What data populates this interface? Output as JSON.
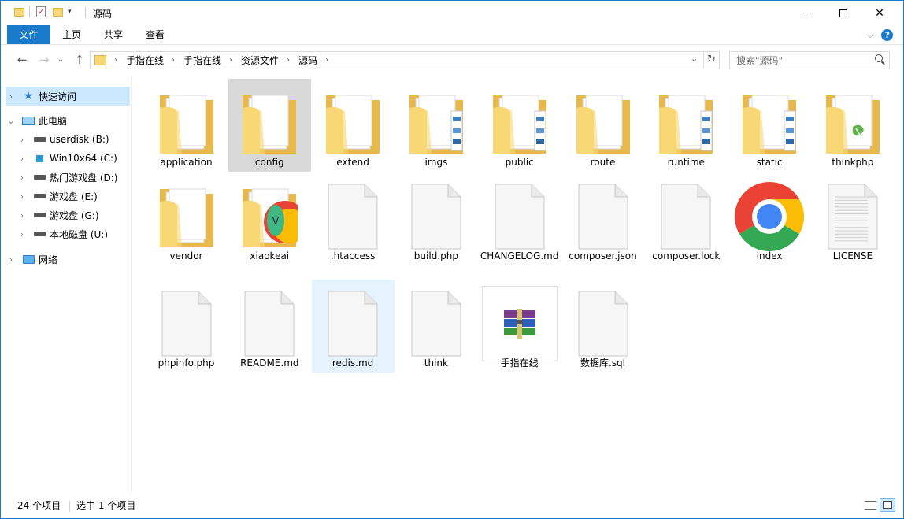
{
  "window": {
    "title": "源码"
  },
  "ribbon": {
    "tabs": [
      {
        "label": "文件"
      },
      {
        "label": "主页"
      },
      {
        "label": "共享"
      },
      {
        "label": "查看"
      }
    ]
  },
  "address": {
    "crumbs": [
      "手指在线",
      "手指在线",
      "资源文件",
      "源码"
    ],
    "search_placeholder": "搜索\"源码\""
  },
  "sidebar": {
    "items": [
      {
        "label": "快速访问",
        "icon": "star-icon"
      },
      {
        "label": "此电脑",
        "icon": "computer-icon"
      },
      {
        "label": "userdisk (B:)",
        "icon": "drive-icon"
      },
      {
        "label": "Win10x64 (C:)",
        "icon": "windows-drive-icon"
      },
      {
        "label": "热门游戏盘 (D:)",
        "icon": "drive-icon"
      },
      {
        "label": "游戏盘 (E:)",
        "icon": "drive-icon"
      },
      {
        "label": "游戏盘 (G:)",
        "icon": "drive-icon"
      },
      {
        "label": "本地磁盘 (U:)",
        "icon": "drive-icon"
      },
      {
        "label": "网络",
        "icon": "network-icon"
      }
    ]
  },
  "files": [
    {
      "name": "application",
      "kind": "folder-docs"
    },
    {
      "name": "config",
      "kind": "folder-docs",
      "state": "selected"
    },
    {
      "name": "extend",
      "kind": "folder-doc"
    },
    {
      "name": "imgs",
      "kind": "folder-images"
    },
    {
      "name": "public",
      "kind": "folder-images"
    },
    {
      "name": "route",
      "kind": "folder-doc"
    },
    {
      "name": "runtime",
      "kind": "folder-images"
    },
    {
      "name": "static",
      "kind": "folder-images"
    },
    {
      "name": "thinkphp",
      "kind": "folder-thinkphp"
    },
    {
      "name": "vendor",
      "kind": "folder-docs"
    },
    {
      "name": "xiaokeai",
      "kind": "folder-vue"
    },
    {
      "name": ".htaccess",
      "kind": "file"
    },
    {
      "name": "build.php",
      "kind": "file"
    },
    {
      "name": "CHANGELOG.md",
      "kind": "file"
    },
    {
      "name": "composer.json",
      "kind": "file"
    },
    {
      "name": "composer.lock",
      "kind": "file"
    },
    {
      "name": "index",
      "kind": "chrome"
    },
    {
      "name": "LICENSE",
      "kind": "text-file"
    },
    {
      "name": "phpinfo.php",
      "kind": "file"
    },
    {
      "name": "README.md",
      "kind": "file"
    },
    {
      "name": "redis.md",
      "kind": "file",
      "state": "hover"
    },
    {
      "name": "think",
      "kind": "file"
    },
    {
      "name": "手指在线",
      "kind": "archive"
    },
    {
      "name": "数据库.sql",
      "kind": "file"
    }
  ],
  "status": {
    "count": "24 个项目",
    "selection": "选中 1 个项目"
  },
  "colors": {
    "accent": "#1979ca",
    "folder": "#f8d775",
    "selection": "#d9d9d9",
    "hover": "#e5f3ff"
  }
}
